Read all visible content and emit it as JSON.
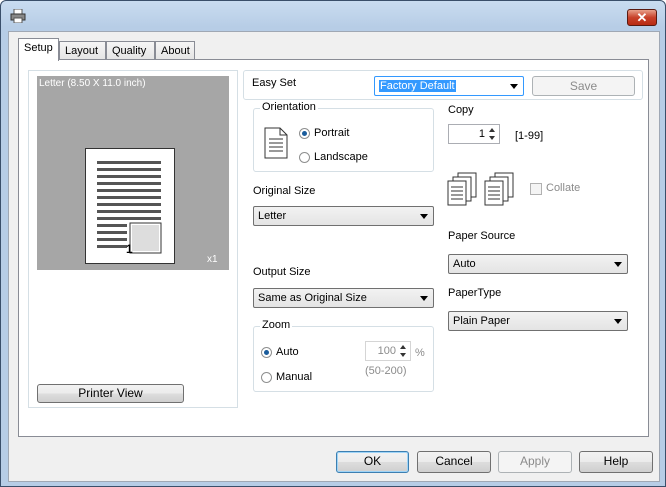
{
  "window": {
    "close_label": "✕"
  },
  "tabs": [
    {
      "label": "Setup",
      "active": true
    },
    {
      "label": "Layout",
      "active": false
    },
    {
      "label": "Quality",
      "active": false
    },
    {
      "label": "About",
      "active": false
    }
  ],
  "preview": {
    "paper_label": "Letter (8.50 X 11.0 inch)",
    "copies_badge": "x1",
    "page_number": "1",
    "printer_view_button": "Printer View"
  },
  "easy_set": {
    "label": "Easy Set",
    "value": "Factory Default",
    "save_button": "Save"
  },
  "orientation": {
    "legend": "Orientation",
    "options": [
      {
        "label": "Portrait",
        "selected": true
      },
      {
        "label": "Landscape",
        "selected": false
      }
    ]
  },
  "original_size": {
    "label": "Original Size",
    "value": "Letter"
  },
  "output_size": {
    "label": "Output Size",
    "value": "Same as Original Size"
  },
  "zoom": {
    "legend": "Zoom",
    "options": [
      {
        "label": "Auto",
        "selected": true
      },
      {
        "label": "Manual",
        "selected": false
      }
    ],
    "value": "100",
    "unit": "%",
    "range": "(50-200)"
  },
  "copy": {
    "label": "Copy",
    "value": "1",
    "range": "[1-99]",
    "collate_label": "Collate",
    "collate_checked": false
  },
  "paper_source": {
    "label": "Paper Source",
    "value": "Auto"
  },
  "paper_type": {
    "label": "PaperType",
    "value": "Plain Paper"
  },
  "footer": {
    "ok": "OK",
    "cancel": "Cancel",
    "apply": "Apply",
    "help": "Help"
  },
  "colors": {
    "title_gradient_top": "#c9dcf0",
    "selection": "#3399ff",
    "close_red": "#c8412a"
  }
}
